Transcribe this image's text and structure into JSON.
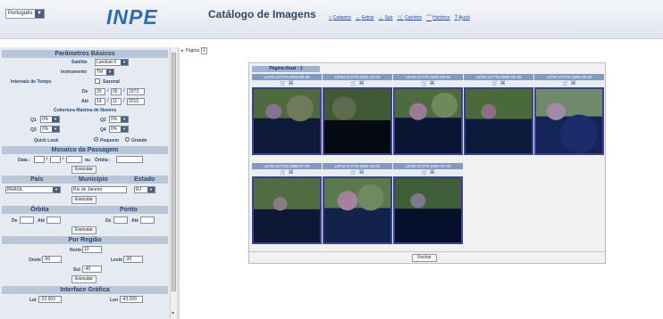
{
  "header": {
    "language": "Português",
    "logo": "INPE",
    "title": "Catálogo de Imagens",
    "nav": [
      "Cadastro",
      "Entrar",
      "Sair",
      "Carrinho",
      "Histórico",
      "Ajuda"
    ]
  },
  "params": {
    "title": "Parâmetros Básicos",
    "satelite_label": "Satélite",
    "satelite_value": "Landsat-5",
    "instrumento_label": "Instrumento",
    "instrumento_value": "TM",
    "intervalo_label": "Intervalo de Tempo",
    "sazonal_label": "Sazonal",
    "de_label": "De",
    "de_day": "29",
    "de_month": "05",
    "de_year": "1973",
    "ate_label": "Até",
    "ate_day": "14",
    "ate_month": "11",
    "ate_year": "2010",
    "cobertura_label": "Cobertura Máxima de Nuvens",
    "q1_label": "Q1",
    "q1_value": "0%",
    "q2_label": "Q2",
    "q2_value": "0%",
    "q3_label": "Q3",
    "q3_value": "0%",
    "q4_label": "Q4",
    "q4_value": "0%",
    "quicklook_label": "Quick Look",
    "pequeno_label": "Pequeno",
    "grande_label": "Grande"
  },
  "mosaico": {
    "title": "Mosaico da Passagem",
    "data_label": "Data :",
    "ou_label": "ou",
    "orbita_label": "Órbita :",
    "executar": "Executar"
  },
  "local": {
    "pais_label": "País",
    "municipio_label": "Município",
    "estado_label": "Estado",
    "pais_value": "BRASIL",
    "municipio_value": "Rio de Janeiro",
    "estado_value": "RJ",
    "executar": "Executar"
  },
  "orbita_ponto": {
    "orbita_label": "Órbita",
    "ponto_label": "Ponto",
    "de_label": "De",
    "ate_label": "Até",
    "de2_label": "De",
    "ate2_label": "Até",
    "executar": "Executar"
  },
  "regiao": {
    "title": "Por Região",
    "norte_label": "Norte",
    "norte_value": "10",
    "oeste_label": "Oeste",
    "oeste_value": "-90",
    "leste_label": "Leste",
    "leste_value": "-30",
    "sul_label": "Sul",
    "sul_value": "-40",
    "executar": "Executar"
  },
  "interface": {
    "title": "Interface Gráfica",
    "lat_label": "Lat",
    "lat_value": "-22.903",
    "lon_label": "Lon",
    "lon_value": "-43.209"
  },
  "results": {
    "tab_label": "Página",
    "tab_page": "1",
    "page_title": "Página Atual : 1",
    "close": "Fechar",
    "scenes": [
      {
        "caption": "L5TM 217/76-2003-09-26"
      },
      {
        "caption": "L5TM 217/76-2001-10-04"
      },
      {
        "caption": "L5TM 217/76-2001-08-01"
      },
      {
        "caption": "L5TM 217/76-2000-05-26"
      },
      {
        "caption": "L5TM 217/76-1990-09-22"
      },
      {
        "caption": "L5TM 217/76-1998-07-09"
      },
      {
        "caption": "L5TM 217/76-1994-10-01"
      },
      {
        "caption": "L5TM 217/76-1984-07-20"
      }
    ]
  }
}
